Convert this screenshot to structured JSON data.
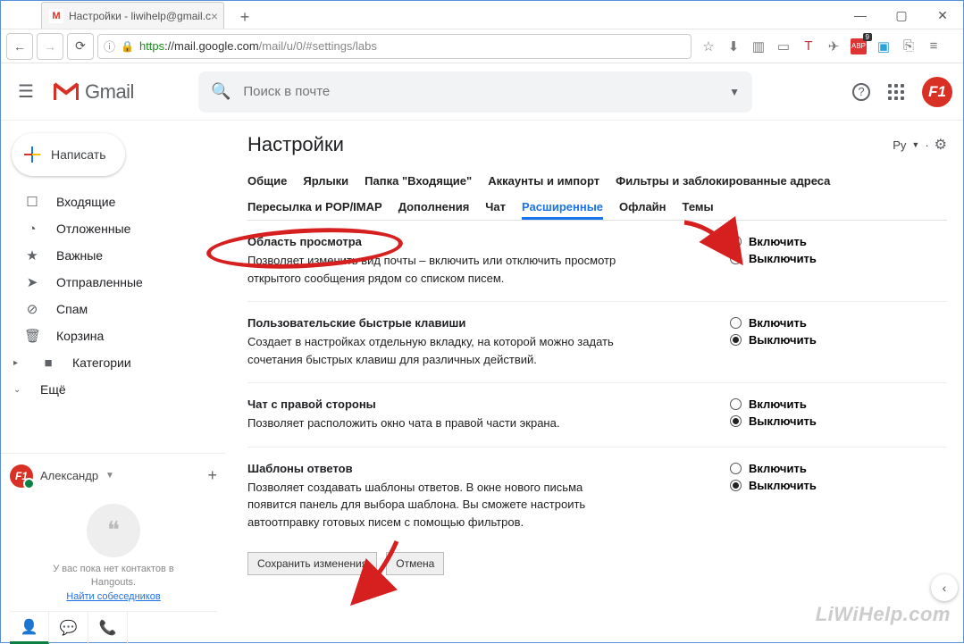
{
  "browser": {
    "tab_title": "Настройки - liwihelp@gmail.c",
    "tab_favicon": "M",
    "url_proto": "https",
    "url_host": "://mail.google.com",
    "url_path": "/mail/u/0/#settings/labs"
  },
  "gmail": {
    "brand": "Gmail",
    "search_placeholder": "Поиск в почте",
    "compose": "Написать",
    "help_tooltip": "?",
    "avatar_initial": "F1"
  },
  "sidebar": {
    "items": [
      {
        "icon": "☐",
        "label": "Входящие"
      },
      {
        "icon": "◔",
        "label": "Отложенные"
      },
      {
        "icon": "★",
        "label": "Важные"
      },
      {
        "icon": "➤",
        "label": "Отправленные"
      },
      {
        "icon": "⊘",
        "label": "Спам"
      },
      {
        "icon": "🗑",
        "label": "Корзина"
      },
      {
        "icon": "▸",
        "label": "Категории",
        "chev": true
      },
      {
        "icon": "⌄",
        "label": "Ещё",
        "chev": true
      }
    ]
  },
  "hangouts": {
    "user": "Александр",
    "empty1": "У вас пока нет контактов в",
    "empty2": "Hangouts.",
    "link": "Найти собеседников"
  },
  "settings": {
    "title": "Настройки",
    "lang": "Ру",
    "tabs_row1": [
      "Общие",
      "Ярлыки",
      "Папка \"Входящие\"",
      "Аккаунты и импорт",
      "Фильтры и заблокированные адреса"
    ],
    "tabs_row2": [
      "Пересылка и POP/IMAP",
      "Дополнения",
      "Чат",
      "Расширенные",
      "Офлайн",
      "Темы"
    ],
    "active_tab": "Расширенные",
    "sections": [
      {
        "title": "Область просмотра",
        "desc": "Позволяет изменить вид почты – включить или отключить просмотр открытого сообщения рядом со списком писем.",
        "enable": "Включить",
        "disable": "Выключить",
        "selected": "enable"
      },
      {
        "title": "Пользовательские быстрые клавиши",
        "desc": "Создает в настройках отдельную вкладку, на которой можно задать сочетания быстрых клавиш для различных действий.",
        "enable": "Включить",
        "disable": "Выключить",
        "selected": "disable"
      },
      {
        "title": "Чат с правой стороны",
        "desc": "Позволяет расположить окно чата в правой части экрана.",
        "enable": "Включить",
        "disable": "Выключить",
        "selected": "disable"
      },
      {
        "title": "Шаблоны ответов",
        "desc": "Позволяет создавать шаблоны ответов. В окне нового письма появится панель для выбора шаблона. Вы сможете настроить автоотправку готовых писем с помощью фильтров.",
        "enable": "Включить",
        "disable": "Выключить",
        "selected": "disable"
      }
    ],
    "save_btn": "Сохранить изменения",
    "cancel_btn": "Отмена"
  },
  "watermark": "LiWiHelp.com"
}
